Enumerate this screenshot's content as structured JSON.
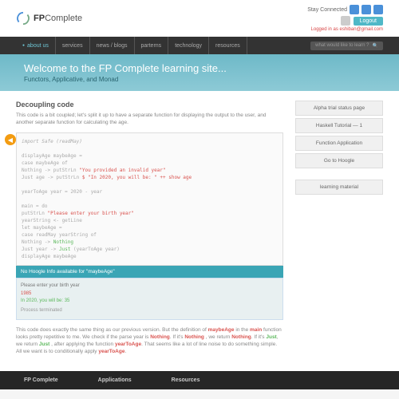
{
  "brand": {
    "name": "FPComplete"
  },
  "top": {
    "stay": "Stay Connected",
    "logout": "Logout",
    "login_as": "Logged in as eshiban@gmail.com"
  },
  "nav": {
    "items": [
      "about us",
      "services",
      "news / blogs",
      "parterns",
      "technology",
      "resources"
    ],
    "search": "what would like to learn ?"
  },
  "hero": {
    "title": "Welcome to the FP Complete learning site...",
    "sub": "Functors, Applicative, and Monad"
  },
  "article": {
    "h": "Decoupling code",
    "p": "This code is a bit coupled; let's split it up to have a separate function for displaying the output to the user, and another separate function for calculating the age."
  },
  "code": {
    "l1": "import Safe (readMay)",
    "l3": "displayAge maybeAge =",
    "l4": "    case maybeAge of",
    "l5a": "        Nothing -> putStrLn ",
    "l5b": "\"You provided an invalid year\"",
    "l6a": "        Just age -> putStrLn ",
    "l6b": "$ \"In 2020, you will be: \" ++ show age",
    "l8": "yearToAge year = 2020 - year",
    "l10": "main = do",
    "l11a": "    putStrLn ",
    "l11b": "\"Please enter your birth year\"",
    "l12": "    yearString <- getLine",
    "l13": "    let maybeAge =",
    "l14": "            case readMay yearString of",
    "l15a": "                Nothing -> ",
    "l15b": "Nothing",
    "l16a": "                Just year -> ",
    "l16b": "Just ",
    "l16c": "(yearToAge year)",
    "l17": "    displayAge maybeAge"
  },
  "info": "No Hoogle Info available for \"maybeAge\"",
  "out": {
    "p1": "Please enter your birth year",
    "p2": "1985",
    "p3": "In 2020, you will be: 35",
    "p4": "Process terminated"
  },
  "after": {
    "t1": "This code does exactly the same thing as our previous version. But the definition of ",
    "m1": "maybeAge",
    "t2": " in the ",
    "m2": "main",
    "t3": " function looks pretty repetitive to me. We check if the parse year is ",
    "m3": "Nothing",
    "t4": ". If it's ",
    "m4": "Nothing",
    "t5": " , we return ",
    "m5": "Nothing",
    "t6": ". If it's ",
    "m6": "Just",
    "t7": ", we return ",
    "m7": "Just",
    "t8": " , after applying the function ",
    "m8": "yearToAge",
    "t9": ". That seems like a lot of line noise to do something simple. All we want is to conditionally apply ",
    "m9": "yearToAge",
    "t10": "."
  },
  "side": {
    "i1": "Alpha trial status page",
    "i2": "Haskell Tutorial — 1",
    "i3": "Function Application",
    "i4": "Go to Hoogle",
    "i5": "learning material"
  },
  "foot": {
    "c1": "FP Complete",
    "c2": "Applications",
    "c3": "Resources"
  }
}
